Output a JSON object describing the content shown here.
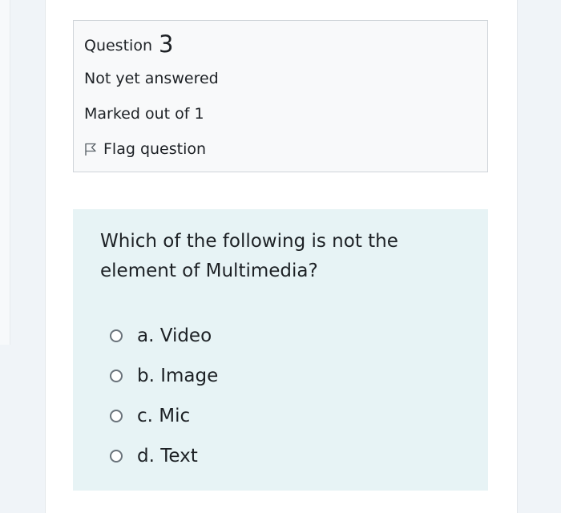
{
  "question_info": {
    "label": "Question",
    "number": "3",
    "state": "Not yet answered",
    "grade": "Marked out of 1",
    "flag_label": "Flag question"
  },
  "question": {
    "text": "Which of the following is not the element of Multimedia?",
    "answers": [
      {
        "label": "a. Video",
        "selected": false
      },
      {
        "label": "b. Image",
        "selected": false
      },
      {
        "label": "c. Mic",
        "selected": false
      },
      {
        "label": "d. Text",
        "selected": false
      }
    ]
  },
  "colors": {
    "info_background": "#f8f9fa",
    "content_background": "#e7f3f5",
    "text": "#1d2125",
    "radio_border": "#6a737b"
  },
  "icons": {
    "flag": "flag-outline-icon"
  }
}
